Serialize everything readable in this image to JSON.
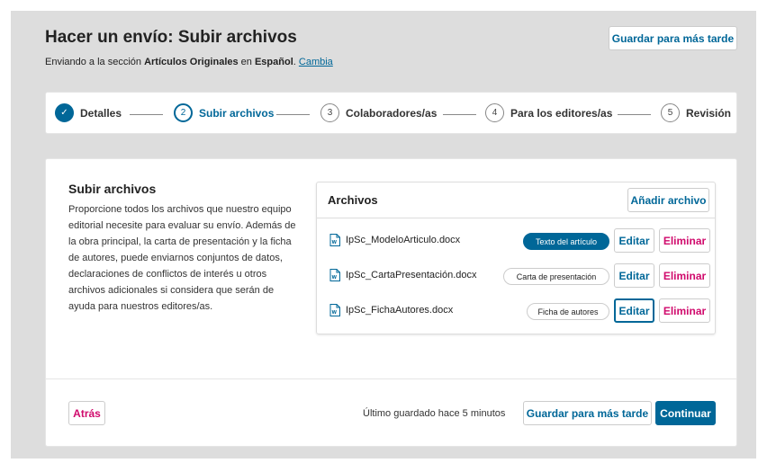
{
  "header": {
    "title": "Hacer un envío: Subir archivos",
    "subtitle_prefix": "Enviando a la sección ",
    "section_name": "Artículos Originales",
    "subtitle_mid": " en ",
    "language": "Español",
    "subtitle_suffix": ". ",
    "change_link": "Cambia",
    "save_later_label": "Guardar para más tarde"
  },
  "steps": [
    {
      "number": "✓",
      "label": "Detalles",
      "state": "done"
    },
    {
      "number": "2",
      "label": "Subir archivos",
      "state": "active"
    },
    {
      "number": "3",
      "label": "Colaboradores/as",
      "state": "pending"
    },
    {
      "number": "4",
      "label": "Para los editores/as",
      "state": "pending"
    },
    {
      "number": "5",
      "label": "Revisión",
      "state": "pending"
    }
  ],
  "upload": {
    "title": "Subir archivos",
    "description": "Proporcione todos los archivos que nuestro equipo editorial necesite para evaluar su envío. Además de la obra principal, la carta de presentación y la ficha de autores, puede enviarnos conjuntos de datos, declaraciones de conflictos de interés u otros archivos adicionales si considera que serán de ayuda para nuestros editores/as."
  },
  "files": {
    "title": "Archivos",
    "add_label": "Añadir archivo",
    "edit_label": "Editar",
    "delete_label": "Eliminar",
    "rows": [
      {
        "name": "IpSc_ModeloArticulo.docx",
        "genre": "Texto del artículo"
      },
      {
        "name": "IpSc_CartaPresentación.docx",
        "genre": "Carta de presentación"
      },
      {
        "name": "IpSc_FichaAutores.docx",
        "genre": "Ficha de autores"
      }
    ]
  },
  "footer": {
    "back_label": "Atrás",
    "last_saved": "Último guardado hace 5 minutos",
    "save_later_label": "Guardar para más tarde",
    "continue_label": "Continuar"
  },
  "colors": {
    "primary": "#006798",
    "danger": "#d00a6c",
    "background": "#dddddd"
  }
}
